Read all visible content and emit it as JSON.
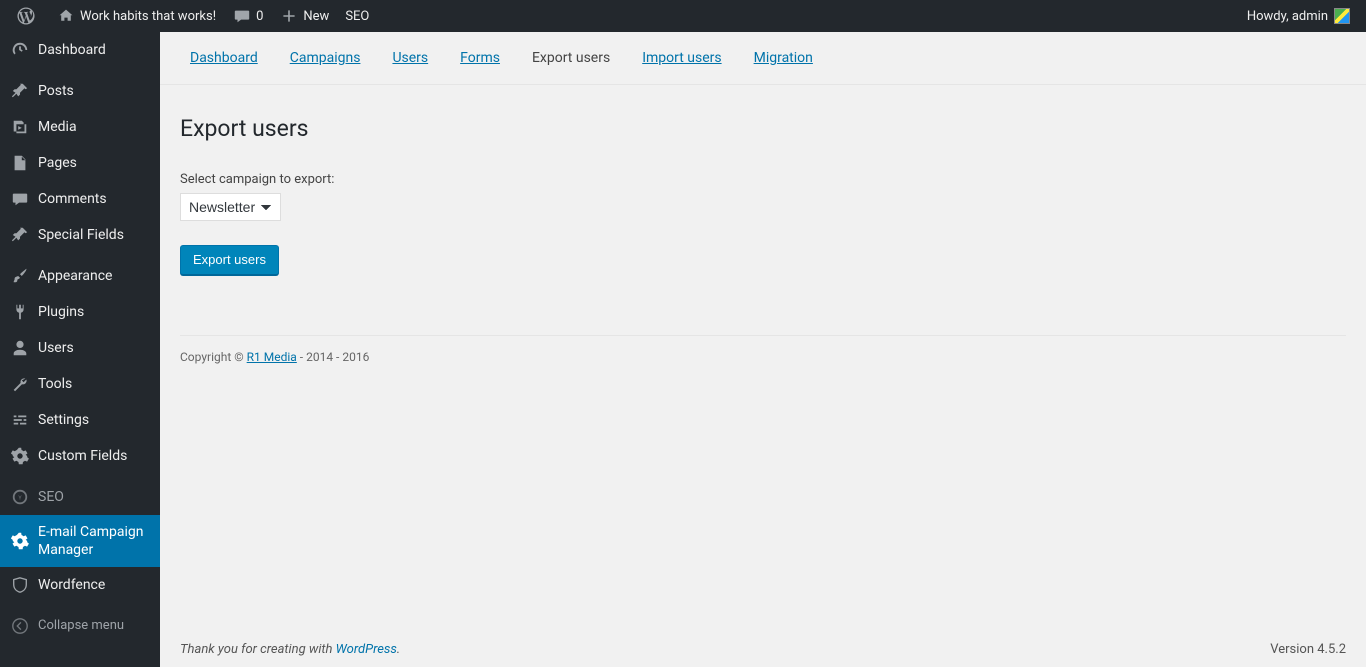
{
  "adminbar": {
    "site_title": "Work habits that works!",
    "comments_count": "0",
    "new_label": "New",
    "seo_label": "SEO",
    "howdy": "Howdy, admin"
  },
  "sidebar": {
    "items": [
      {
        "label": "Dashboard",
        "icon": "dashboard"
      },
      {
        "label": "Posts",
        "icon": "pin"
      },
      {
        "label": "Media",
        "icon": "media"
      },
      {
        "label": "Pages",
        "icon": "page"
      },
      {
        "label": "Comments",
        "icon": "comment"
      },
      {
        "label": "Special Fields",
        "icon": "pin"
      },
      {
        "label": "Appearance",
        "icon": "brush"
      },
      {
        "label": "Plugins",
        "icon": "plug"
      },
      {
        "label": "Users",
        "icon": "user"
      },
      {
        "label": "Tools",
        "icon": "wrench"
      },
      {
        "label": "Settings",
        "icon": "sliders"
      },
      {
        "label": "Custom Fields",
        "icon": "gear"
      },
      {
        "label": "SEO",
        "icon": "seo"
      },
      {
        "label": "E-mail Campaign Manager",
        "icon": "gear"
      },
      {
        "label": "Wordfence",
        "icon": "shield"
      }
    ],
    "collapse_label": "Collapse menu"
  },
  "tabs": {
    "items": [
      {
        "label": "Dashboard",
        "active": false
      },
      {
        "label": "Campaigns",
        "active": false
      },
      {
        "label": "Users",
        "active": false
      },
      {
        "label": "Forms",
        "active": false
      },
      {
        "label": "Export users",
        "active": true
      },
      {
        "label": "Import users",
        "active": false
      },
      {
        "label": "Migration",
        "active": false
      }
    ]
  },
  "page": {
    "title": "Export users",
    "form_label": "Select campaign to export:",
    "campaign_selected": "Newsletter",
    "button_label": "Export users"
  },
  "plugin_footer": {
    "copyright_prefix": "Copyright © ",
    "link_text": "R1 Media",
    "copyright_suffix": " - 2014 - 2016"
  },
  "wp_footer": {
    "thank_you_prefix": "Thank you for creating with ",
    "wp_link": "WordPress",
    "suffix": ".",
    "version": "Version 4.5.2"
  }
}
